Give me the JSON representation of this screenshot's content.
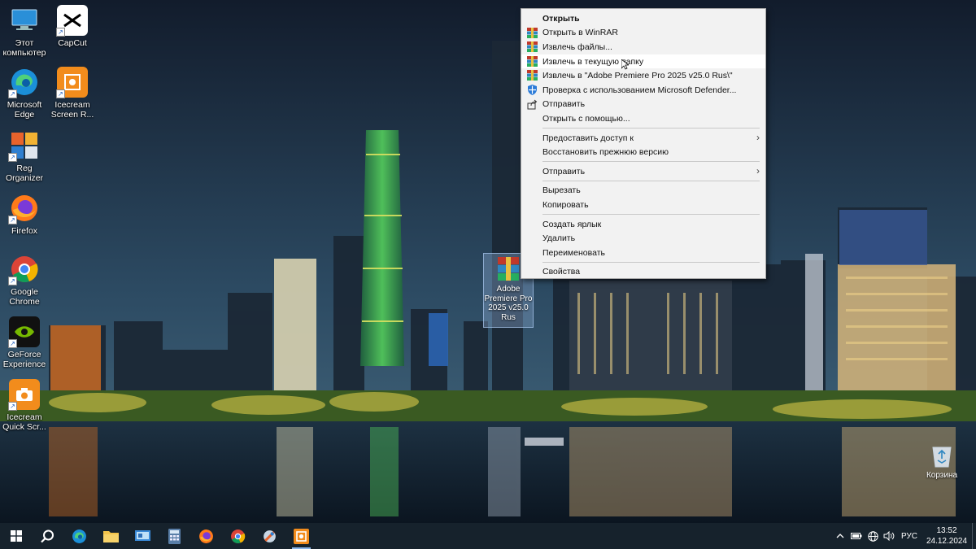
{
  "desktop_icons": [
    {
      "label": "Этот\nкомпьютер",
      "icon": "this-pc-icon"
    },
    {
      "label": "CapCut",
      "icon": "capcut-icon"
    },
    {
      "label": "Microsoft\nEdge",
      "icon": "edge-icon"
    },
    {
      "label": "Icecream\nScreen R...",
      "icon": "icecream-recorder-icon"
    },
    {
      "label": "Reg\nOrganizer",
      "icon": "reg-organizer-icon"
    },
    {
      "label": "Firefox",
      "icon": "firefox-icon"
    },
    {
      "label": "Google\nChrome",
      "icon": "chrome-icon"
    },
    {
      "label": "GeForce\nExperience",
      "icon": "geforce-icon"
    },
    {
      "label": "Icecream\nQuick Scr...",
      "icon": "icecream-quick-icon"
    }
  ],
  "file_item": {
    "label": "Adobe\nPremiere Pro\n2025 v25.0\nRus",
    "icon": "winrar-archive-icon"
  },
  "recycle_bin": {
    "label": "Корзина",
    "icon": "recycle-bin-icon"
  },
  "context_menu": {
    "items": [
      {
        "label": "Открыть",
        "bold": true
      },
      {
        "label": "Открыть в WinRAR",
        "icon": "winrar-icon"
      },
      {
        "label": "Извлечь файлы...",
        "icon": "winrar-icon"
      },
      {
        "label": "Извлечь в текущую папку",
        "icon": "winrar-icon",
        "hover": true
      },
      {
        "label": "Извлечь в \"Adobe Premiere Pro 2025 v25.0 Rus\\\"",
        "icon": "winrar-icon"
      },
      {
        "label": "Проверка с использованием Microsoft Defender...",
        "icon": "defender-icon"
      },
      {
        "label": "Отправить",
        "icon": "share-icon"
      },
      {
        "label": "Открыть с помощью..."
      },
      {
        "separator": true
      },
      {
        "label": "Предоставить доступ к",
        "submenu": true
      },
      {
        "label": "Восстановить прежнюю версию"
      },
      {
        "separator": true
      },
      {
        "label": "Отправить",
        "submenu": true
      },
      {
        "separator": true
      },
      {
        "label": "Вырезать"
      },
      {
        "label": "Копировать"
      },
      {
        "separator": true
      },
      {
        "label": "Создать ярлык"
      },
      {
        "label": "Удалить"
      },
      {
        "label": "Переименовать"
      },
      {
        "separator": true
      },
      {
        "label": "Свойства"
      }
    ]
  },
  "taskbar": {
    "buttons": [
      {
        "name": "start-button",
        "icon": "windows-icon"
      },
      {
        "name": "search-button",
        "icon": "search-icon"
      },
      {
        "name": "taskbar-edge",
        "icon": "edge-icon"
      },
      {
        "name": "taskbar-explorer",
        "icon": "folder-icon"
      },
      {
        "name": "taskbar-control-panel",
        "icon": "control-panel-icon"
      },
      {
        "name": "taskbar-calculator",
        "icon": "calculator-icon"
      },
      {
        "name": "taskbar-firefox",
        "icon": "firefox-icon"
      },
      {
        "name": "taskbar-chrome",
        "icon": "chrome-icon"
      },
      {
        "name": "taskbar-reg-organizer",
        "icon": "reg-organizer-icon"
      },
      {
        "name": "taskbar-icecream",
        "icon": "icecream-icon",
        "active": true
      }
    ],
    "tray": {
      "language": "РУС",
      "time": "13:52",
      "date": "24.12.2024"
    }
  },
  "colors": {
    "menu_bg": "#f2f2f2",
    "menu_hover": "#ffffff",
    "taskbar_bg": "#16222c",
    "accent": "#8ab4e8"
  }
}
